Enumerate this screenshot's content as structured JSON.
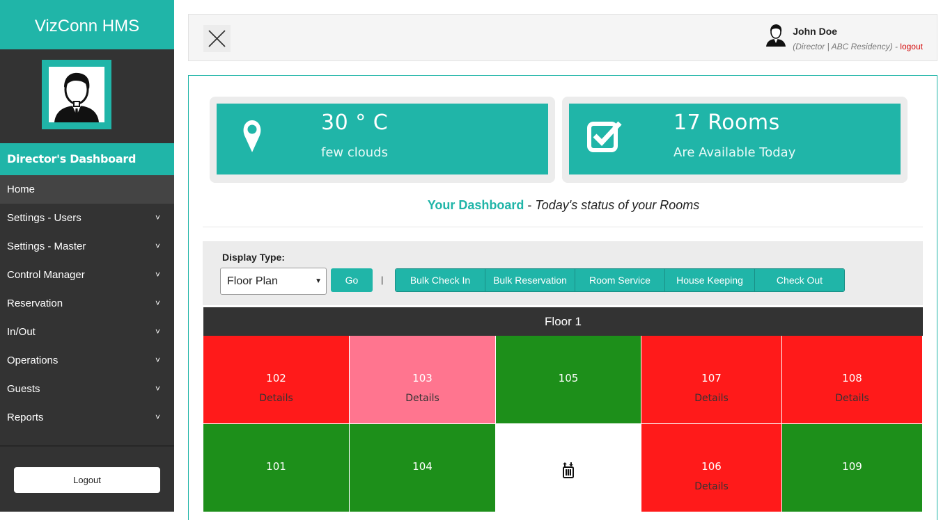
{
  "app": {
    "title": "VizConn HMS"
  },
  "sidebar": {
    "role_title": "Director's Dashboard",
    "items": [
      {
        "label": "Home",
        "active": true,
        "has_submenu": false
      },
      {
        "label": "Settings - Users",
        "has_submenu": true
      },
      {
        "label": "Settings - Master",
        "has_submenu": true
      },
      {
        "label": "Control Manager",
        "has_submenu": true
      },
      {
        "label": "Reservation",
        "has_submenu": true
      },
      {
        "label": "In/Out",
        "has_submenu": true
      },
      {
        "label": "Operations",
        "has_submenu": true
      },
      {
        "label": "Guests",
        "has_submenu": true
      },
      {
        "label": "Reports",
        "has_submenu": true
      }
    ],
    "chevron": "˅",
    "logout_label": "Logout"
  },
  "topbar": {
    "user_name": "John Doe",
    "user_meta": "(Director | ABC Residency)",
    "meta_sep": " - ",
    "logout_link": "logout"
  },
  "cards": {
    "weather": {
      "value": "30 ° C",
      "desc": "few clouds",
      "icon": "location-pin-icon"
    },
    "rooms": {
      "value": "17 Rooms",
      "desc": "Are Available Today",
      "icon": "checkbox-icon"
    }
  },
  "dashboard": {
    "highlight": "Your Dashboard",
    "dash": " - ",
    "subtitle": "Today's status of your Rooms"
  },
  "toolbar": {
    "display_label": "Display Type:",
    "select_value": "Floor Plan",
    "select_arrow": "▼",
    "go_label": "Go",
    "separator": "|",
    "actions": [
      {
        "label": "Bulk Check In"
      },
      {
        "label": "Bulk Reservation"
      },
      {
        "label": "Room Service"
      },
      {
        "label": "House Keeping"
      },
      {
        "label": "Check Out"
      }
    ]
  },
  "floor": {
    "title": "Floor 1",
    "rooms": [
      {
        "number": "102",
        "details": "Details",
        "color": "#ff1a1a"
      },
      {
        "number": "103",
        "details": "Details",
        "color": "#ff758f"
      },
      {
        "number": "105",
        "details": "",
        "color": "#1d8f1a"
      },
      {
        "number": "107",
        "details": "Details",
        "color": "#ff1a1a"
      },
      {
        "number": "108",
        "details": "Details",
        "color": "#ff1a1a"
      },
      {
        "number": "101",
        "details": "",
        "color": "#1d8f1a"
      },
      {
        "number": "104",
        "details": "",
        "color": "#1d8f1a"
      },
      {
        "number": "",
        "details": "",
        "color": "#ffffff",
        "icon": "elevator-icon"
      },
      {
        "number": "106",
        "details": "Details",
        "color": "#ff1a1a"
      },
      {
        "number": "109",
        "details": "",
        "color": "#1d8f1a"
      }
    ]
  },
  "colors": {
    "accent": "#20b5a8",
    "sidebar": "#333333"
  }
}
